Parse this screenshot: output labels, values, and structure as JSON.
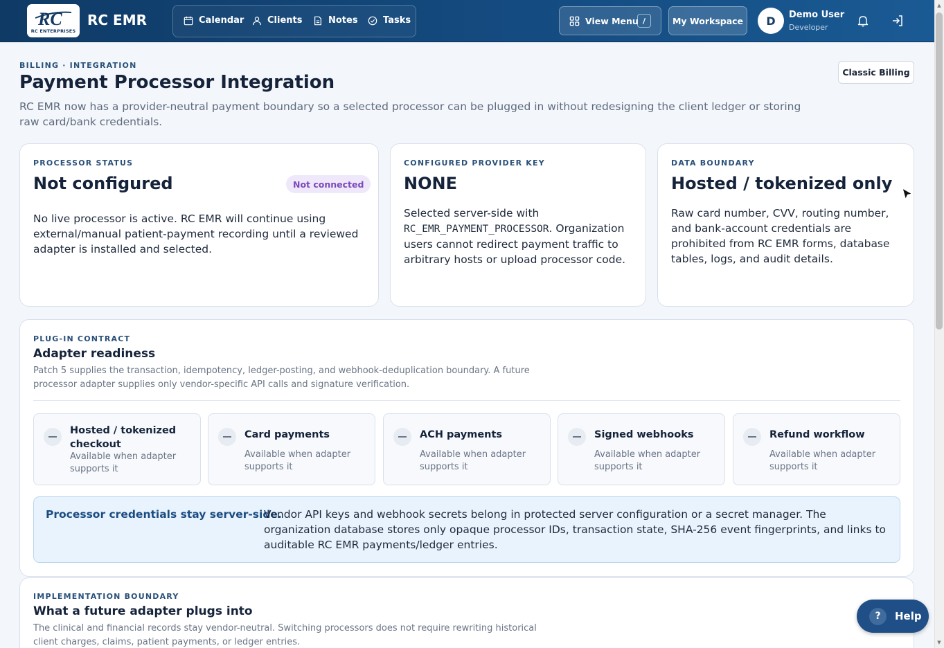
{
  "header": {
    "app_title": "RC EMR",
    "logo_text": "RC ENTERPRISES",
    "nav": [
      {
        "label": "Calendar",
        "icon": "calendar-icon"
      },
      {
        "label": "Clients",
        "icon": "user-icon"
      },
      {
        "label": "Notes",
        "icon": "document-icon"
      },
      {
        "label": "Tasks",
        "icon": "check-circle-icon"
      }
    ],
    "view_menu_label": "View Menu",
    "view_menu_shortcut": "/",
    "workspace_label": "My Workspace",
    "user": {
      "initial": "D",
      "name": "Demo User",
      "role": "Developer"
    },
    "colors": {
      "bar_start": "#0f3a66",
      "bar_end": "#1a5a94"
    }
  },
  "page": {
    "eyebrow": "BILLING · INTEGRATION",
    "title": "Payment Processor Integration",
    "description": "RC EMR now has a provider-neutral payment boundary so a selected processor can be plugged in without redesigning the client ledger or storing raw card/bank credentials.",
    "classic_billing_label": "Classic Billing"
  },
  "status_cards": [
    {
      "eyebrow": "PROCESSOR STATUS",
      "value": "Not configured",
      "badge": "Not connected",
      "body": "No live processor is active. RC EMR will continue using external/manual patient-payment recording until a reviewed adapter is installed and selected."
    },
    {
      "eyebrow": "CONFIGURED PROVIDER KEY",
      "value": "NONE",
      "body_prefix": "Selected server-side with",
      "body_code": "RC_EMR_PAYMENT_PROCESSOR",
      "body_suffix": ". Organization users cannot redirect payment traffic to arbitrary hosts or upload processor code."
    },
    {
      "eyebrow": "DATA BOUNDARY",
      "value": "Hosted / tokenized only",
      "body": "Raw card number, CVV, routing number, and bank-account credentials are prohibited from RC EMR forms, database tables, logs, and audit details."
    }
  ],
  "contract": {
    "eyebrow": "PLUG-IN CONTRACT",
    "title": "Adapter readiness",
    "description": "Patch 5 supplies the transaction, idempotency, ledger-posting, and webhook-deduplication boundary. A future processor adapter supplies only vendor-specific API calls and signature verification.",
    "capabilities": [
      {
        "title": "Hosted / tokenized checkout",
        "status": "Available when adapter supports it"
      },
      {
        "title": "Card payments",
        "status": "Available when adapter supports it"
      },
      {
        "title": "ACH payments",
        "status": "Available when adapter supports it"
      },
      {
        "title": "Signed webhooks",
        "status": "Available when adapter supports it"
      },
      {
        "title": "Refund workflow",
        "status": "Available when adapter supports it"
      }
    ],
    "note_title": "Processor credentials stay server-side.",
    "note_body": "Vendor API keys and webhook secrets belong in protected server configuration or a secret manager. The organization database stores only opaque processor IDs, transaction state, SHA-256 event fingerprints, and links to auditable RC EMR payments/ledger entries."
  },
  "implementation": {
    "eyebrow": "IMPLEMENTATION BOUNDARY",
    "title": "What a future adapter plugs into",
    "description": "The clinical and financial records stay vendor-neutral. Switching processors does not require rewriting historical client charges, claims, patient payments, or ledger entries."
  },
  "help": {
    "icon_glyph": "?",
    "label": "Help"
  }
}
